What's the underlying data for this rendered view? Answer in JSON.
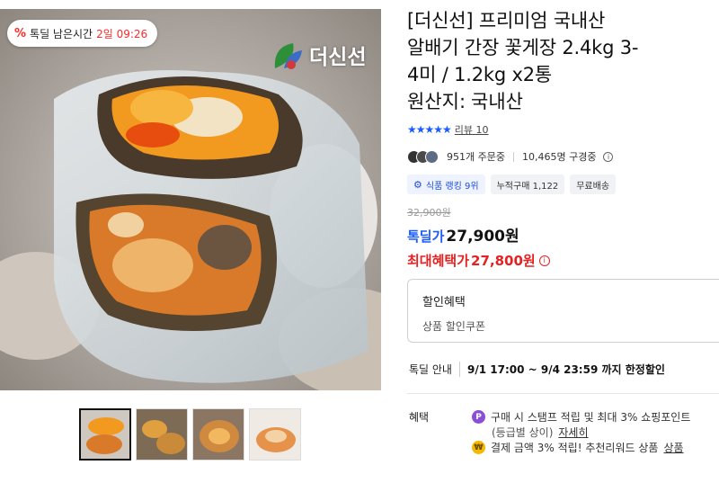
{
  "hero": {
    "timer_label": "톡딜 남은시간",
    "timer_value": "2일 09:26",
    "brand": "더신선"
  },
  "product": {
    "title": "[더신선] 프리미엄 국내산\n알배기 간장 꽃게장 2.4kg 3-\n4미 / 1.2kg x2통",
    "origin_label": "원산지:",
    "origin_value": "국내산",
    "rating_stars": "★★★★★",
    "review_link": "리뷰 10",
    "orders": "951개 주문중",
    "subscribers": "10,465명 구경중",
    "chips": [
      "식품 랭킹 9위",
      "누적구매 1,122",
      "무료배송"
    ]
  },
  "price": {
    "original": "32,900원",
    "tdeal_label": "톡딜가",
    "tdeal_value": "27,900원",
    "max_label": "최대혜택가",
    "max_value": "27,800원"
  },
  "discount": {
    "title": "할인혜택",
    "sub": "상품 할인쿠폰"
  },
  "tdeal_info": {
    "label": "톡딜 안내",
    "period": "9/1 17:00 ~ 9/4 23:59 까지 한정할인"
  },
  "benefit": {
    "label": "혜택",
    "line1": "구매 시 스탬프 적립 및 최대 3% 쇼핑포인트",
    "line2_prefix": "(등급별 상이)",
    "line2_link": "자세히",
    "line3": "결제 금액 3% 적립! 추천리워드 상품",
    "line3_link": "상품"
  },
  "colors": {
    "accent_blue": "#1a5cff",
    "accent_red": "#e52222"
  }
}
